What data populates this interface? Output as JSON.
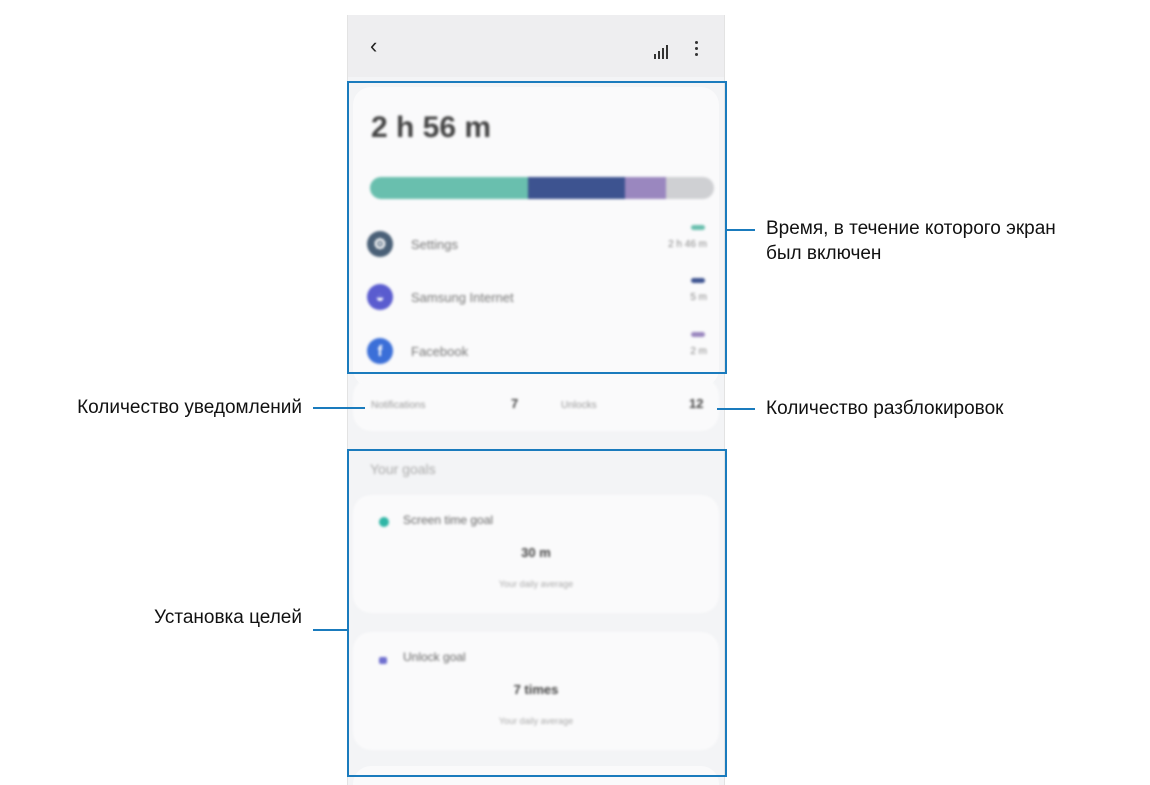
{
  "colors": {
    "accent_blue": "#1a7bbd",
    "bar_teal": "#69bfae",
    "bar_navy": "#3d5390",
    "bar_purple": "#9a87bf",
    "bar_grey": "#cfd0d3"
  },
  "header": {
    "back_icon": "chevron-left-icon",
    "chart_icon": "bar-chart-icon",
    "more_icon": "more-vertical-icon"
  },
  "usage": {
    "total_time": "2 h 56 m",
    "bar_segments": [
      {
        "color": "#69bfae",
        "fraction": 0.46
      },
      {
        "color": "#3d5390",
        "fraction": 0.28
      },
      {
        "color": "#9a87bf",
        "fraction": 0.12
      },
      {
        "color": "#cfd0d3",
        "fraction": 0.14
      }
    ],
    "apps": [
      {
        "name": "Settings",
        "time": "2 h 46 m",
        "icon": "gear-icon",
        "icon_color": "#4a6077",
        "dash_color": "#69bfae"
      },
      {
        "name": "Samsung Internet",
        "time": "5 m",
        "icon": "globe-icon",
        "icon_color": "#5a5ccf",
        "dash_color": "#3d5390"
      },
      {
        "name": "Facebook",
        "time": "2 m",
        "icon": "facebook-icon",
        "icon_color": "#3b6fd8",
        "dash_color": "#9a87bf"
      }
    ]
  },
  "stats": {
    "notifications_label": "Notifications",
    "notifications_value": "7",
    "unlocks_label": "Unlocks",
    "unlocks_value": "12"
  },
  "goals": {
    "header": "Your goals",
    "screen_time": {
      "title": "Screen time goal",
      "value": "30 m",
      "note": "Your daily average",
      "icon": "clock-icon"
    },
    "unlock": {
      "title": "Unlock goal",
      "value": "7 times",
      "note": "Your daily average",
      "icon": "lock-icon"
    }
  },
  "callouts": {
    "screen_time_line1": "Время, в течение которого экран",
    "screen_time_line2": "был включен",
    "notifications": "Количество уведомлений",
    "unlocks": "Количество разблокировок",
    "goals": "Установка целей"
  }
}
